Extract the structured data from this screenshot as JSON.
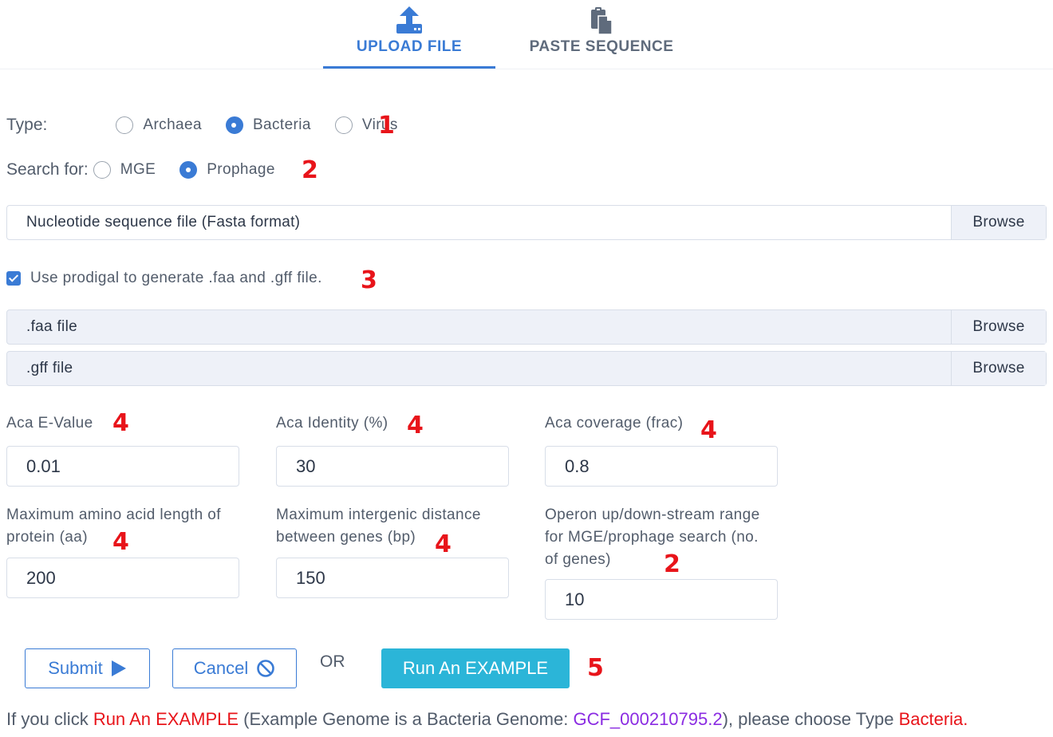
{
  "tabs": [
    {
      "label": "UPLOAD FILE",
      "icon": "upload-icon",
      "active": true
    },
    {
      "label": "PASTE SEQUENCE",
      "icon": "clipboard-icon",
      "active": false
    }
  ],
  "type_row": {
    "label": "Type:",
    "options": [
      "Archaea",
      "Bacteria",
      "Virus"
    ],
    "selected": "Bacteria",
    "annotation": "1"
  },
  "search_row": {
    "label": "Search for:",
    "options": [
      "MGE",
      "Prophage"
    ],
    "selected": "Prophage",
    "annotation": "2"
  },
  "nucleotide_file": {
    "placeholder": "Nucleotide sequence file (Fasta format)",
    "browse": "Browse"
  },
  "prodigal": {
    "label": "Use prodigal to generate .faa and .gff file.",
    "checked": true,
    "annotation": "3"
  },
  "faa_file": {
    "placeholder": ".faa file",
    "browse": "Browse"
  },
  "gff_file": {
    "placeholder": ".gff file",
    "browse": "Browse"
  },
  "params": [
    {
      "label": "Aca E-Value",
      "value": "0.01",
      "annotation": "4"
    },
    {
      "label": "Aca Identity (%)",
      "value": "30",
      "annotation": "4"
    },
    {
      "label": "Aca coverage (frac)",
      "value": "0.8",
      "annotation": "4"
    },
    {
      "label_lines": [
        "Maximum amino acid length of",
        "protein (aa)"
      ],
      "value": "200",
      "annotation": "4"
    },
    {
      "label_lines": [
        "Maximum intergenic distance",
        "between genes (bp)"
      ],
      "value": "150",
      "annotation": "4"
    },
    {
      "label_lines": [
        "Operon up/down-stream range",
        "for MGE/prophage search (no.",
        "of genes)"
      ],
      "value": "10",
      "annotation": "2"
    }
  ],
  "actions": {
    "submit": "Submit",
    "cancel": "Cancel",
    "or": "OR",
    "example": "Run An EXAMPLE",
    "annotation": "5"
  },
  "note": {
    "part1": "If you click ",
    "part2": "Run An EXAMPLE",
    "part3": " (Example Genome is a Bacteria Genome: ",
    "part4": "GCF_000210795.2",
    "part5": "), please choose Type ",
    "part6": "Bacteria",
    "part7": "."
  },
  "colors": {
    "accent": "#3a7bd5",
    "annotation": "#e8141a",
    "example_button": "#2bb5d8",
    "link_purple": "#8a2be2"
  }
}
